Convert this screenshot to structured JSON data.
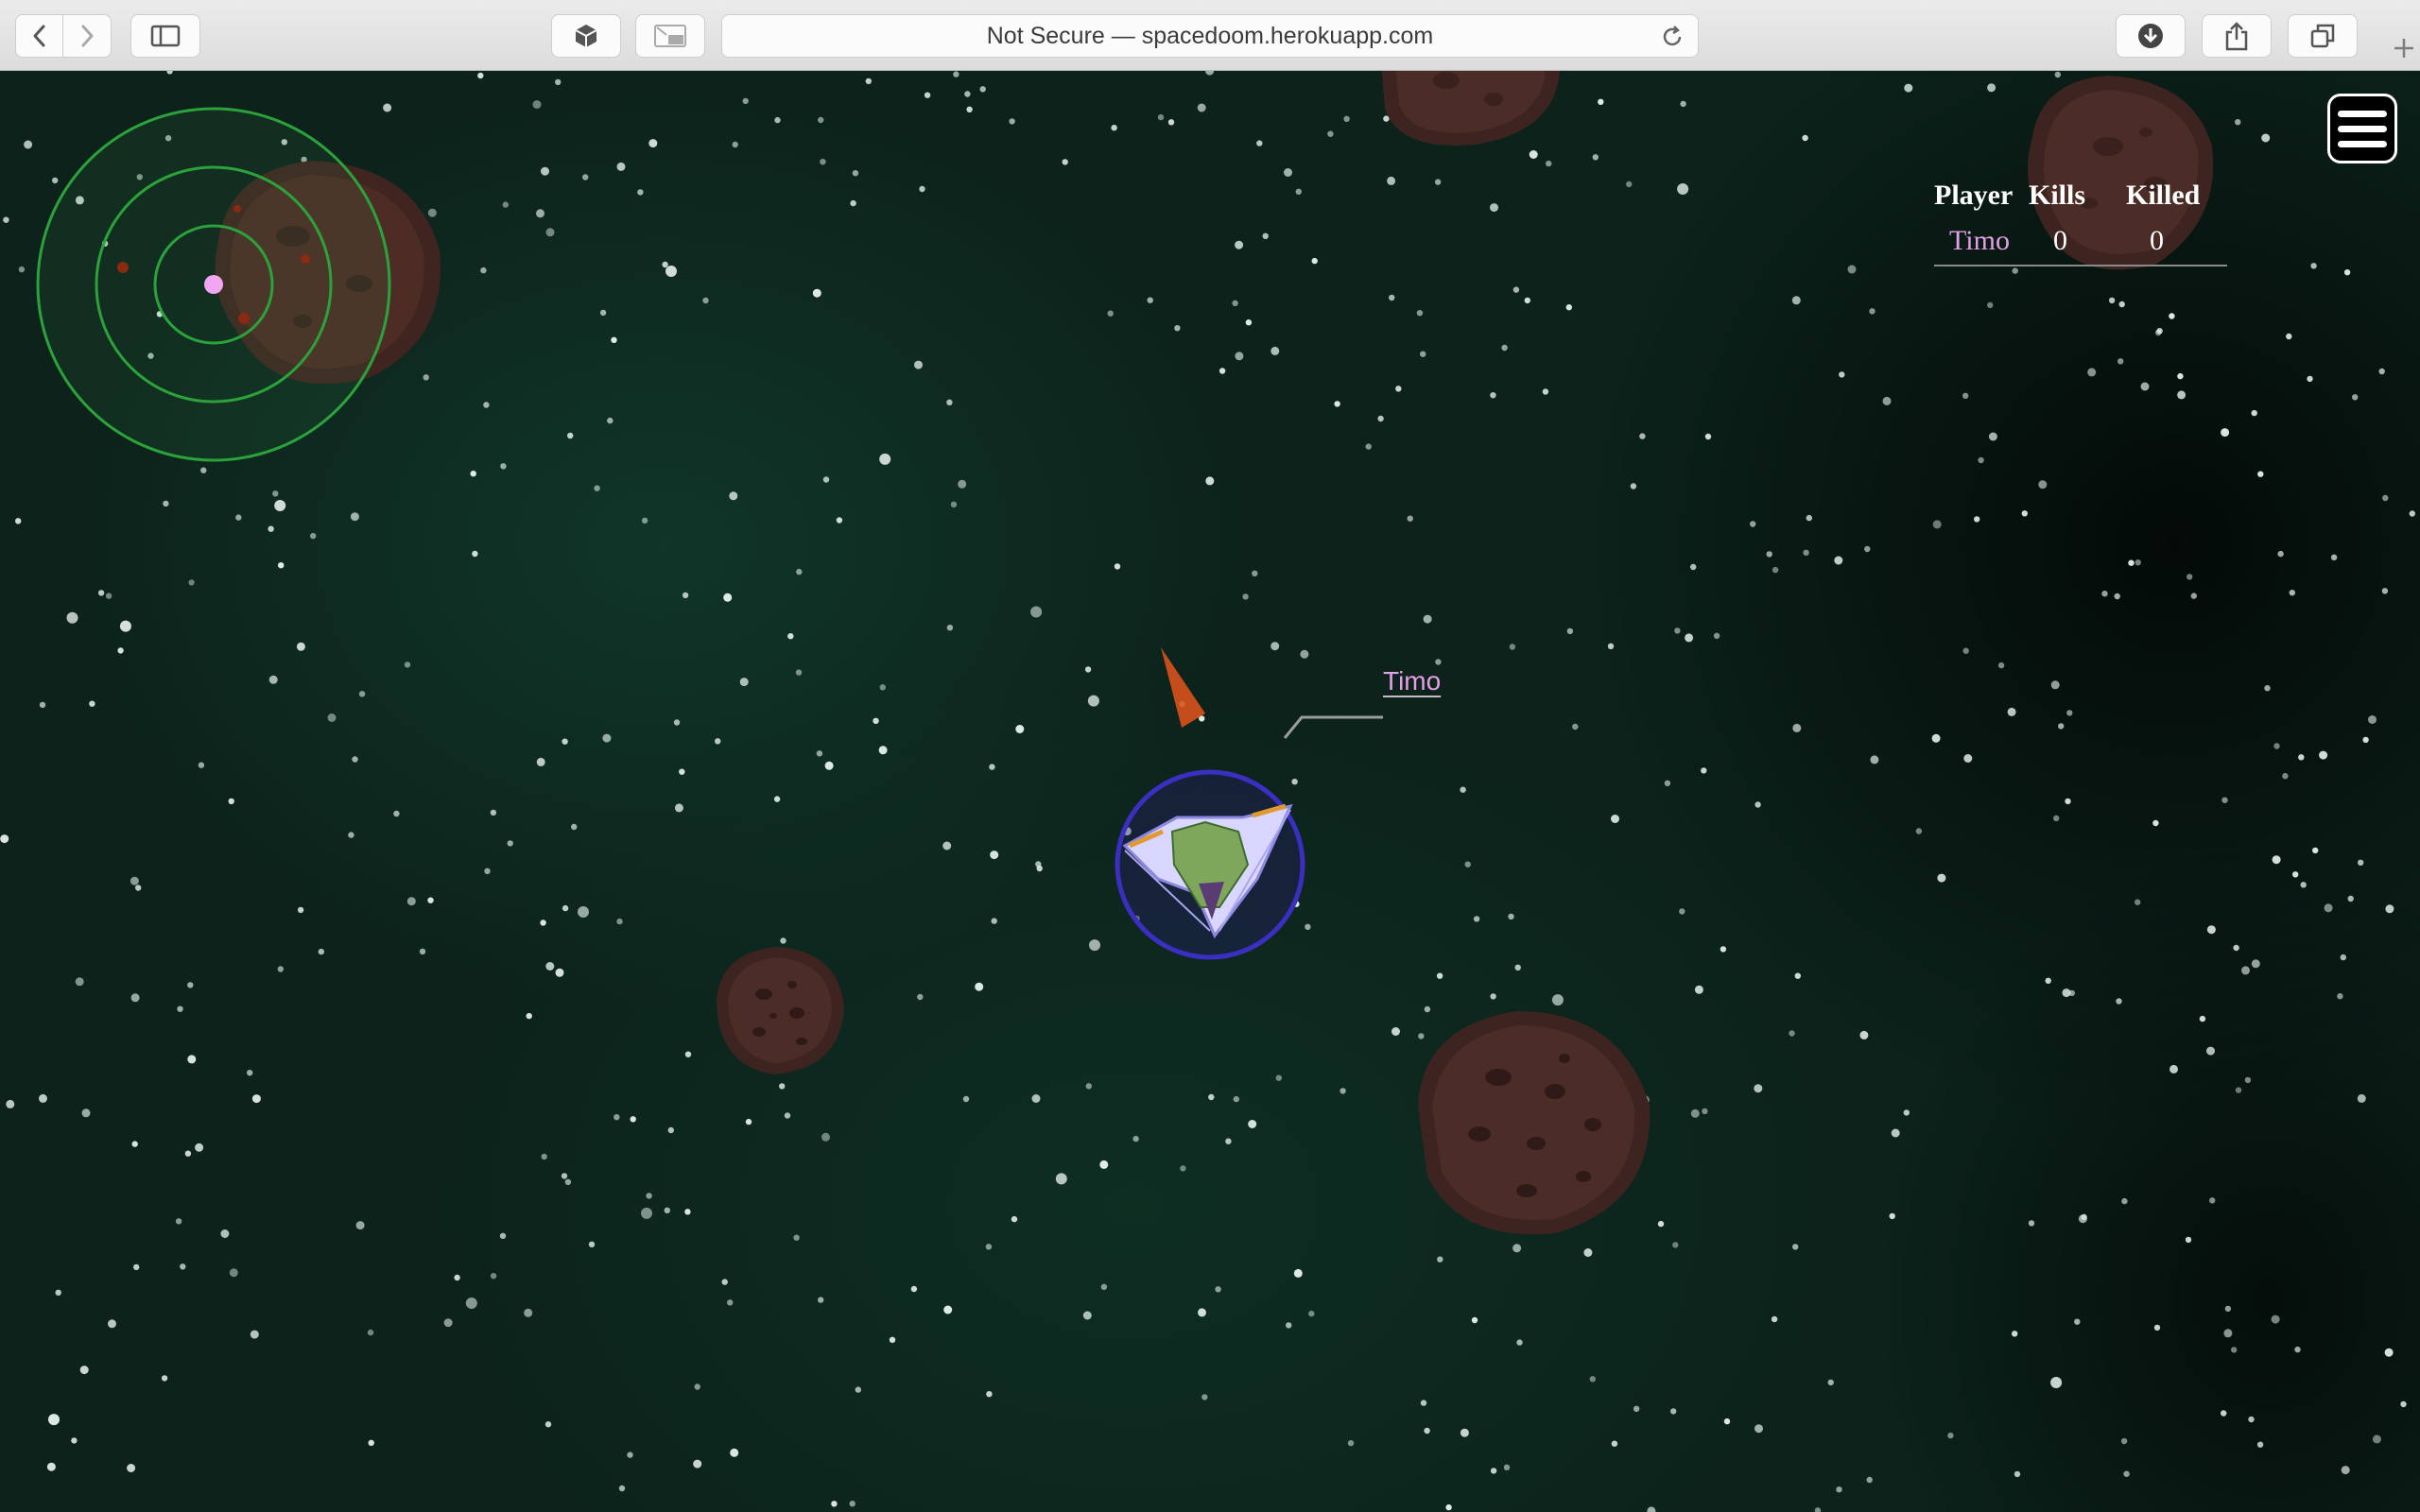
{
  "browser": {
    "address_text": "Not Secure — spacedoom.herokuapp.com",
    "icons": [
      "back-icon",
      "forward-icon",
      "sidebar-icon",
      "cube-icon",
      "picture-in-picture-icon",
      "reload-icon",
      "download-icon",
      "share-icon",
      "tabs-icon",
      "plus-icon"
    ]
  },
  "game": {
    "player": {
      "name": "Timo",
      "name_color": "#e3a0e6"
    },
    "scoreboard": {
      "headers": {
        "player": "Player",
        "kills": "Kills",
        "killed": "Killed"
      },
      "rows": [
        {
          "player": "Timo",
          "kills": "0",
          "killed": "0"
        }
      ]
    },
    "colors": {
      "radar": "#2ca23a",
      "shield": "#3a2fc0",
      "asteroid": "#4a2a22",
      "thruster": "#d8521c"
    }
  }
}
